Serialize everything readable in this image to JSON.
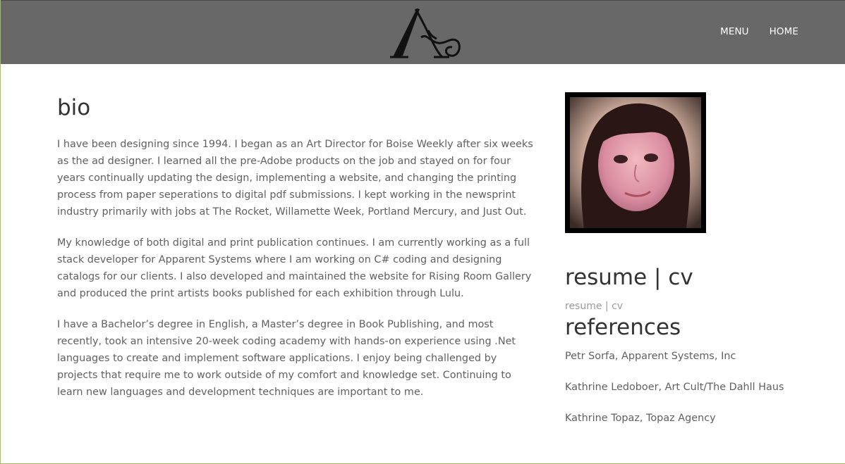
{
  "header": {
    "logo_icon": "script-a-monogram-logo",
    "nav": [
      {
        "label": "MENU"
      },
      {
        "label": "HOME"
      }
    ]
  },
  "bio": {
    "title": "bio",
    "paragraphs": [
      "I have been designing since 1994. I began as an Art Director for Boise Weekly after six weeks as the ad designer. I learned all the pre-Adobe products on the job and stayed on for four years continually updating the design, implementing a website, and changing the printing process from paper seperations to digital pdf submissions. I kept working in the newsprint industry primarily with jobs at The Rocket, Willamette Week, Portland Mercury, and Just Out.",
      "My knowledge of both digital and print publication continues. I am currently working as a full stack developer for Apparent Systems where I am working on C# coding and designing catalogs for our clients. I also developed and maintained the website for Rising Room Gallery and produced the print artists books published for each exhibition through Lulu.",
      "I have a Bachelor’s degree in English, a Master’s degree in Book Publishing, and most recently, took an intensive 20-week coding academy with hands-on experience using .Net languages to create and implement software applications. I enjoy being challenged by projects that require me to work outside of my comfort and knowledge set. Continuing to learn new languages and development techniques are important to me."
    ]
  },
  "sidebar": {
    "resume_title": "resume | cv",
    "resume_link": "resume | cv",
    "references_title": "references",
    "references": [
      "Petr Sorfa, Apparent Systems, Inc",
      "Kathrine Ledoboer, Art Cult/The Dahll Haus",
      "Kathrine Topaz, Topaz Agency"
    ]
  },
  "colors": {
    "header_bg": "#686868",
    "nav_text": "#ffffff",
    "body_text": "#606060",
    "heading_text": "#333333",
    "link_muted": "#9a9a9a",
    "frame_accent": "#9fc05a"
  }
}
